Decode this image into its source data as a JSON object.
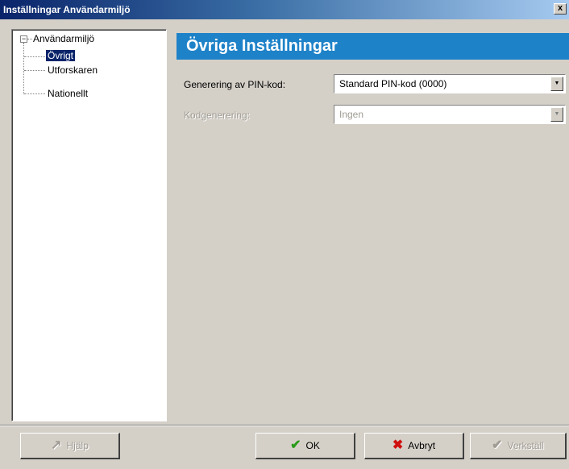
{
  "window": {
    "title": "Inställningar Användarmiljö",
    "close_label": "x"
  },
  "tree": {
    "expander": "−",
    "root": "Användarmiljö",
    "children": [
      "Övrigt",
      "Utforskaren",
      "Nationellt"
    ],
    "selected": "Övrigt"
  },
  "panel": {
    "header": "Övriga Inställningar",
    "header_color": "#1e82c8",
    "fields": [
      {
        "label": "Generering av PIN-kod:",
        "value": "Standard PIN-kod (0000)",
        "enabled": true
      },
      {
        "label": "Kodgenerering:",
        "value": "Ingen",
        "enabled": false
      }
    ]
  },
  "buttons": {
    "help": {
      "label": "Hjälp",
      "icon": "help-icon",
      "enabled": false
    },
    "ok": {
      "label": "OK",
      "icon": "checkmark-icon",
      "icon_color": "#2a9a1a",
      "enabled": true
    },
    "cancel": {
      "label": "Avbryt",
      "icon": "x-icon",
      "icon_color": "#d01010",
      "enabled": true
    },
    "apply": {
      "label": "Verkställ",
      "icon": "apply-icon",
      "enabled": false
    }
  }
}
